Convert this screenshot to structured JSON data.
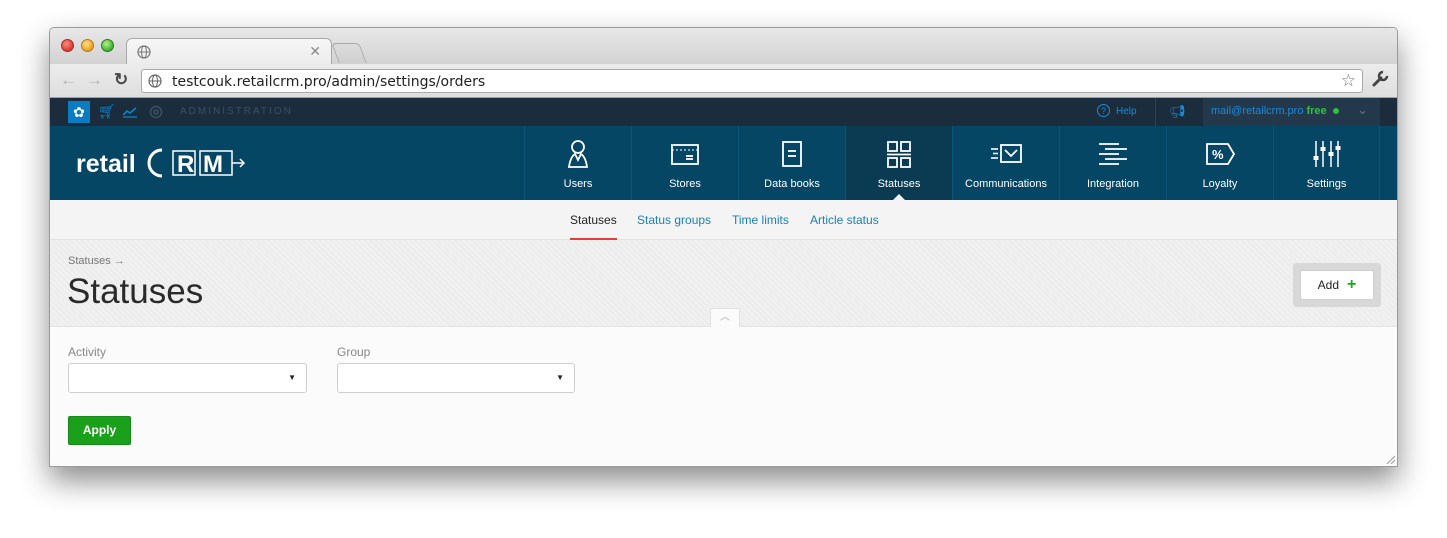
{
  "browser": {
    "tab_title": "",
    "url": "testcouk.retailcrm.pro/admin/settings/orders"
  },
  "adminbar": {
    "section_label": "ADMINISTRATION",
    "help_label": "Help",
    "account_email": "mail@retailcrm.pro",
    "plan_label": "free"
  },
  "logo": {
    "text_retail": "retail",
    "text_crm": "CRM"
  },
  "nav": {
    "items": [
      {
        "label": "Users",
        "icon": "user-icon"
      },
      {
        "label": "Stores",
        "icon": "store-icon"
      },
      {
        "label": "Data books",
        "icon": "book-icon"
      },
      {
        "label": "Statuses",
        "icon": "statuses-icon"
      },
      {
        "label": "Communications",
        "icon": "mail-icon"
      },
      {
        "label": "Integration",
        "icon": "integration-icon"
      },
      {
        "label": "Loyalty",
        "icon": "percent-tag-icon"
      },
      {
        "label": "Settings",
        "icon": "sliders-icon"
      }
    ],
    "active": "Statuses"
  },
  "subnav": {
    "items": [
      "Statuses",
      "Status groups",
      "Time limits",
      "Article status"
    ],
    "active": "Statuses"
  },
  "page": {
    "breadcrumb": "Statuses →",
    "title": "Statuses",
    "add_label": "Add"
  },
  "filters": {
    "activity_label": "Activity",
    "activity_value": "",
    "group_label": "Group",
    "group_value": "",
    "apply_label": "Apply"
  },
  "colors": {
    "nav_bg": "#054665",
    "admin_bar_bg": "#1b2d3c",
    "link": "#1a7fba",
    "accent_green": "#1ba01b",
    "active_underline": "#e23c3c"
  }
}
